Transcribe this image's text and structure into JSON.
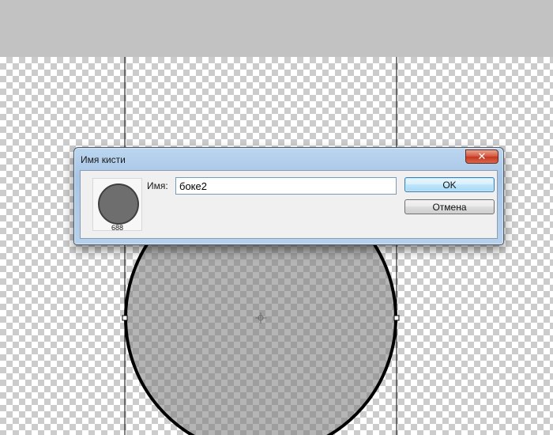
{
  "dialog": {
    "title": "Имя кисти",
    "close_symbol": "✕",
    "brush_preview": {
      "size": "688"
    },
    "name_label": "Имя:",
    "name_value": "боке2",
    "ok_label": "OK",
    "cancel_label": "Отмена"
  },
  "canvas": {
    "shape": "ellipse-selection",
    "fill_color": "#808080",
    "stroke_color": "#000000"
  },
  "colors": {
    "workspace": "#c2c2c2",
    "dialog_frame": "#b6d1ec",
    "close_button": "#d4533b",
    "ok_border": "#3c7fb1"
  }
}
